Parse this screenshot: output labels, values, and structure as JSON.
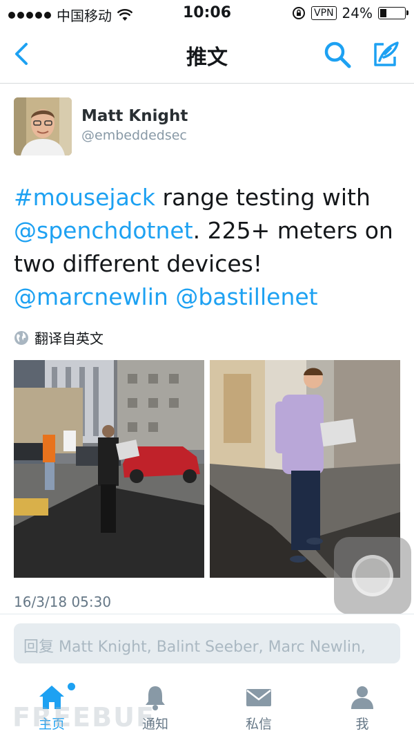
{
  "status_bar": {
    "carrier": "中国移动",
    "time": "10:06",
    "vpn": "VPN",
    "battery": "24%"
  },
  "nav": {
    "title": "推文",
    "back_icon": "chevron-left-icon",
    "search_icon": "search-icon",
    "compose_icon": "compose-icon"
  },
  "tweet": {
    "name": "Matt Knight",
    "handle": "@embeddedsec",
    "body": {
      "hashtag": "#mousejack",
      "t1": " range testing with ",
      "mention1": "@spenchdotnet",
      "t2": ". 225+ meters on two different devices! ",
      "mention2": "@marcnewlin",
      "t3": " ",
      "mention3": "@bastillenet"
    },
    "translate": "翻译自英文",
    "timestamp": "16/3/18 05:30"
  },
  "reply": {
    "placeholder": "回复 Matt Knight, Balint Seeber, Marc Newlin,"
  },
  "tabs": [
    {
      "label": "主页",
      "icon": "home-icon",
      "active": true
    },
    {
      "label": "通知",
      "icon": "bell-icon",
      "active": false
    },
    {
      "label": "私信",
      "icon": "mail-icon",
      "active": false
    },
    {
      "label": "我",
      "icon": "person-icon",
      "active": false
    }
  ],
  "watermark": "FREEBUF",
  "colors": {
    "accent": "#1da1f2",
    "text": "#14171a",
    "muted": "#657786"
  }
}
